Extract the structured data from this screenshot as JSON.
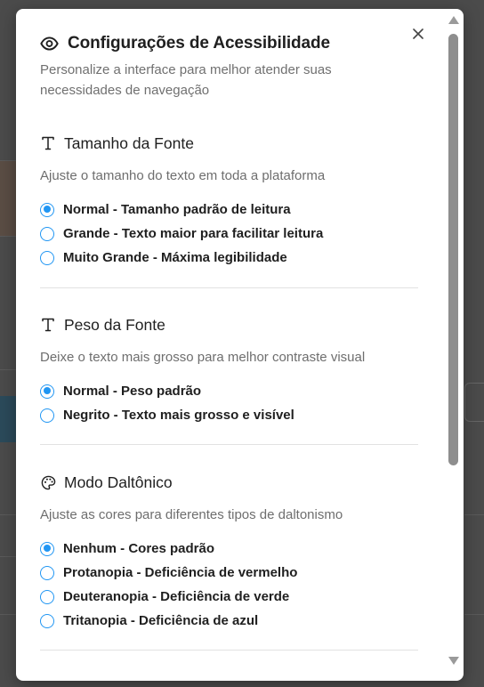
{
  "modal": {
    "title": "Configurações de Acessibilidade",
    "subtitle": "Personalize a interface para melhor atender suas necessidades de navegação",
    "close_label": "×"
  },
  "sections": [
    {
      "title": "Tamanho da Fonte",
      "icon": "type-icon",
      "description": "Ajuste o tamanho do texto em toda a plataforma",
      "options": [
        {
          "label": "Normal - Tamanho padrão de leitura",
          "checked": true
        },
        {
          "label": "Grande - Texto maior para facilitar leitura",
          "checked": false
        },
        {
          "label": "Muito Grande - Máxima legibilidade",
          "checked": false
        }
      ]
    },
    {
      "title": "Peso da Fonte",
      "icon": "type-icon",
      "description": "Deixe o texto mais grosso para melhor contraste visual",
      "options": [
        {
          "label": "Normal - Peso padrão",
          "checked": true
        },
        {
          "label": "Negrito - Texto mais grosso e visível",
          "checked": false
        }
      ]
    },
    {
      "title": "Modo Daltônico",
      "icon": "palette-icon",
      "description": "Ajuste as cores para diferentes tipos de daltonismo",
      "options": [
        {
          "label": "Nenhum - Cores padrão",
          "checked": true
        },
        {
          "label": "Protanopia - Deficiência de vermelho",
          "checked": false
        },
        {
          "label": "Deuteranopia - Deficiência de verde",
          "checked": false
        },
        {
          "label": "Tritanopia - Deficiência de azul",
          "checked": false
        }
      ]
    }
  ],
  "colors": {
    "accent": "#2196f3",
    "overlay": "#4b4b4b"
  }
}
